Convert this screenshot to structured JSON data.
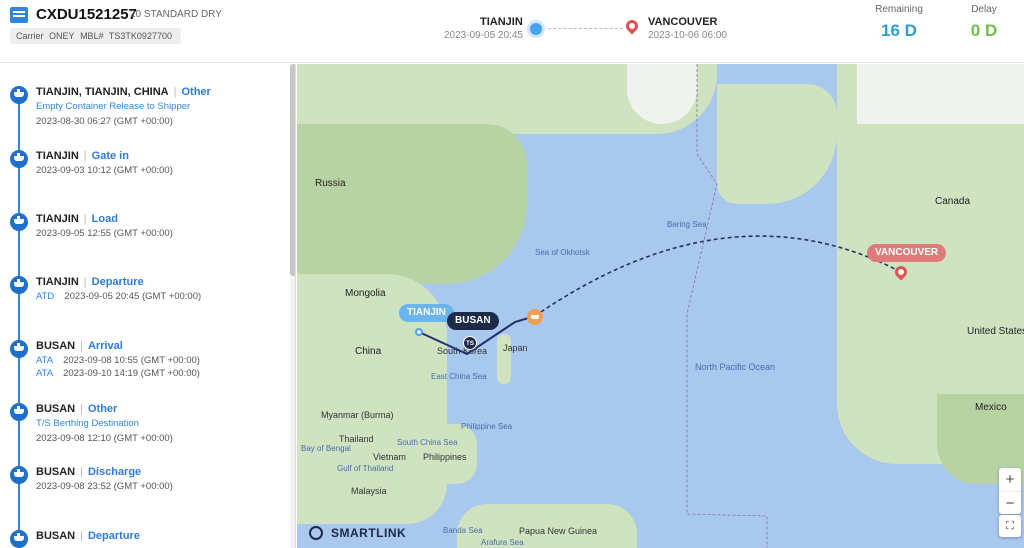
{
  "header": {
    "container_no": "CXDU1521257",
    "container_type": "20 STANDARD DRY",
    "carrier_label": "Carrier",
    "carrier": "ONEY",
    "mbl_label": "MBL#",
    "mbl": "TS3TK0927700",
    "origin": {
      "name": "TIANJIN",
      "time": "2023-09-05 20:45"
    },
    "destination": {
      "name": "VANCOUVER",
      "time": "2023-10-06 06:00"
    },
    "remaining": {
      "label": "Remaining",
      "value": "16 D"
    },
    "delay": {
      "label": "Delay",
      "value": "0 D"
    }
  },
  "events": [
    {
      "location": "TIANJIN, TIANJIN, CHINA",
      "type": "Other",
      "subtitle": "Empty Container Release to Shipper",
      "times": [
        {
          "badge": "",
          "value": "2023-08-30 06:27 (GMT +00:00)"
        }
      ]
    },
    {
      "location": "TIANJIN",
      "type": "Gate in",
      "subtitle": "",
      "times": [
        {
          "badge": "",
          "value": "2023-09-03 10:12 (GMT +00:00)"
        }
      ]
    },
    {
      "location": "TIANJIN",
      "type": "Load",
      "subtitle": "",
      "times": [
        {
          "badge": "",
          "value": "2023-09-05 12:55 (GMT +00:00)"
        }
      ]
    },
    {
      "location": "TIANJIN",
      "type": "Departure",
      "subtitle": "",
      "times": [
        {
          "badge": "ATD",
          "value": "2023-09-05 20:45 (GMT +00:00)"
        }
      ]
    },
    {
      "location": "BUSAN",
      "type": "Arrival",
      "subtitle": "",
      "times": [
        {
          "badge": "ATA",
          "value": "2023-09-08 10:55 (GMT +00:00)"
        },
        {
          "badge": "ATA",
          "value": "2023-09-10 14:19 (GMT +00:00)"
        }
      ]
    },
    {
      "location": "BUSAN",
      "type": "Other",
      "subtitle": "T/S Berthing Destination",
      "times": [
        {
          "badge": "",
          "value": "2023-09-08 12:10 (GMT +00:00)"
        }
      ]
    },
    {
      "location": "BUSAN",
      "type": "Discharge",
      "subtitle": "",
      "times": [
        {
          "badge": "",
          "value": "2023-09-08 23:52 (GMT +00:00)"
        }
      ]
    },
    {
      "location": "BUSAN",
      "type": "Departure",
      "subtitle": "",
      "times": []
    }
  ],
  "map": {
    "labels": {
      "russia": "Russia",
      "mongolia": "Mongolia",
      "china": "China",
      "japan": "Japan",
      "south_korea": "South Korea",
      "myanmar": "Myanmar (Burma)",
      "thailand": "Thailand",
      "vietnam": "Vietnam",
      "philippines": "Philippines",
      "malaysia": "Malaysia",
      "papua": "Papua New Guinea",
      "canada": "Canada",
      "united_states": "United States",
      "mexico": "Mexico",
      "bering_sea": "Bering Sea",
      "sea_of_okhotsk": "Sea of Okhotsk",
      "east_china_sea": "East China Sea",
      "philippine_sea": "Philippine Sea",
      "south_china_sea": "South China Sea",
      "bay_of_bengal": "Bay of Bengal",
      "gulf_of_thailand": "Gulf of Thailand",
      "banda_sea": "Banda Sea",
      "arafura_sea": "Arafura Sea",
      "north_pacific_ocean": "North Pacific Ocean"
    },
    "tags": {
      "tianjin": "TIANJIN",
      "busan": "BUSAN",
      "vancouver": "VANCOUVER"
    },
    "ts_badge": "TS",
    "zoom_in": "+",
    "zoom_out": "−",
    "fullscreen": "⛶",
    "brand": "SMARTLINK"
  }
}
